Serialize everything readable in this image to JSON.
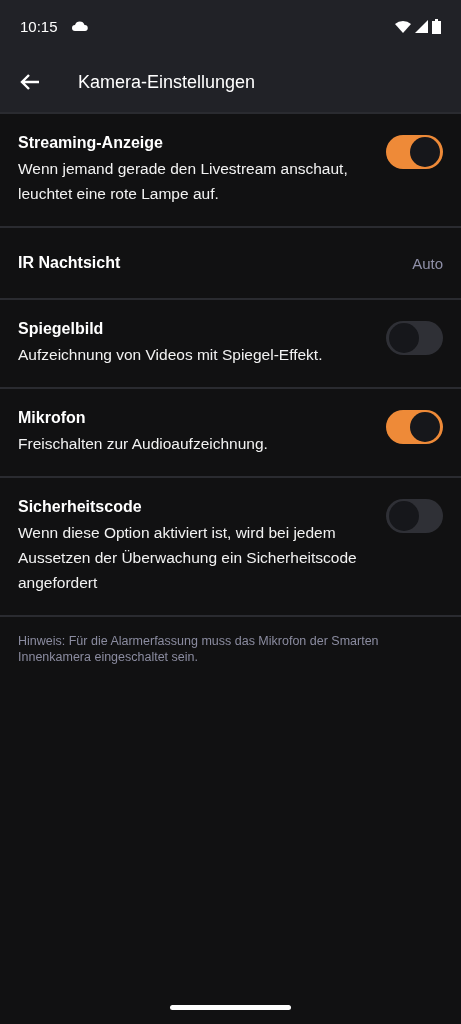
{
  "status_bar": {
    "time": "10:15"
  },
  "app_bar": {
    "title": "Kamera-Einstellungen"
  },
  "settings": [
    {
      "kind": "toggle",
      "title": "Streaming-Anzeige",
      "description": "Wenn jemand gerade den Livestream anschaut, leuchtet eine rote Lampe auf.",
      "on": true
    },
    {
      "kind": "value",
      "title": "IR Nachtsicht",
      "value": "Auto"
    },
    {
      "kind": "toggle",
      "title": "Spiegelbild",
      "description": "Aufzeichnung von Videos mit Spiegel-Effekt.",
      "on": false
    },
    {
      "kind": "toggle",
      "title": "Mikrofon",
      "description": "Freischalten zur Audioaufzeichnung.",
      "on": true
    },
    {
      "kind": "toggle",
      "title": "Sicherheitscode",
      "description": "Wenn diese Option aktiviert ist, wird bei jedem Aussetzen der Überwachung ein Sicherheitscode angefordert",
      "on": false
    }
  ],
  "hint": "Hinweis: Für die Alarmerfassung muss das Mikrofon der Smarten Innenkamera eingeschaltet sein."
}
